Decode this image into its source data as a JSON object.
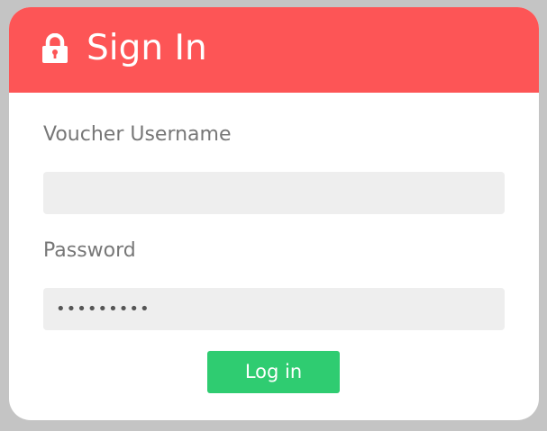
{
  "header": {
    "title": "Sign In",
    "icon": "lock-icon",
    "background_color": "#fd5556"
  },
  "form": {
    "username": {
      "label": "Voucher Username",
      "value": ""
    },
    "password": {
      "label": "Password",
      "value": "•••••••••"
    },
    "submit_label": "Log in",
    "submit_color": "#2fcc71"
  }
}
